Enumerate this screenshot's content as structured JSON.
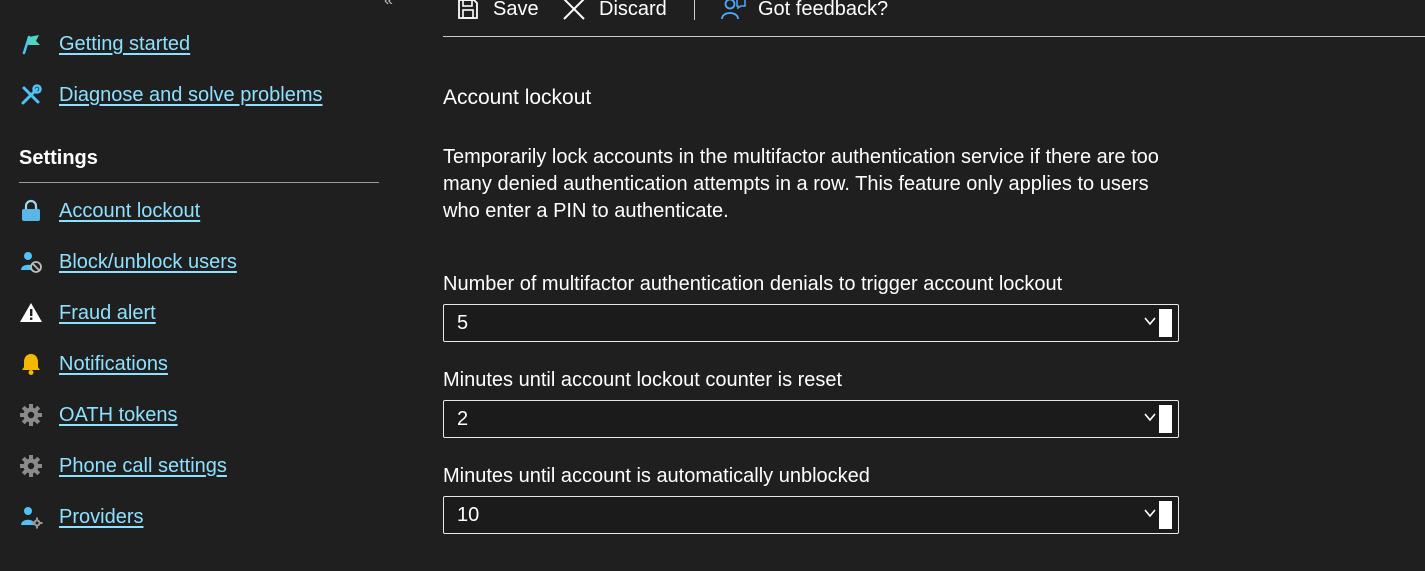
{
  "sidebar": {
    "collapse_glyph": "«",
    "top_items": [
      {
        "label": "Getting started",
        "icon": "flag-icon"
      },
      {
        "label": "Diagnose and solve problems",
        "icon": "wrench-icon"
      }
    ],
    "settings_heading": "Settings",
    "settings_items": [
      {
        "label": "Account lockout",
        "icon": "lock-icon"
      },
      {
        "label": "Block/unblock users",
        "icon": "user-block-icon"
      },
      {
        "label": "Fraud alert",
        "icon": "warning-icon"
      },
      {
        "label": "Notifications",
        "icon": "bell-icon"
      },
      {
        "label": "OATH tokens",
        "icon": "gear-icon"
      },
      {
        "label": "Phone call settings",
        "icon": "gear-icon"
      },
      {
        "label": "Providers",
        "icon": "user-settings-icon"
      }
    ]
  },
  "toolbar": {
    "save_label": "Save",
    "discard_label": "Discard",
    "feedback_label": "Got feedback?"
  },
  "main": {
    "title": "Account lockout",
    "description": "Temporarily lock accounts in the multifactor authentication service if there are too many denied authentication attempts in a row. This feature only applies to users who enter a PIN to authenticate.",
    "fields": [
      {
        "label": "Number of multifactor authentication denials to trigger account lockout",
        "value": "5"
      },
      {
        "label": "Minutes until account lockout counter is reset",
        "value": "2"
      },
      {
        "label": "Minutes until account is automatically unblocked",
        "value": "10"
      }
    ]
  },
  "colors": {
    "background": "#1f1f1f",
    "link": "#8ee0ff",
    "accent_blue": "#4fc3f7"
  }
}
